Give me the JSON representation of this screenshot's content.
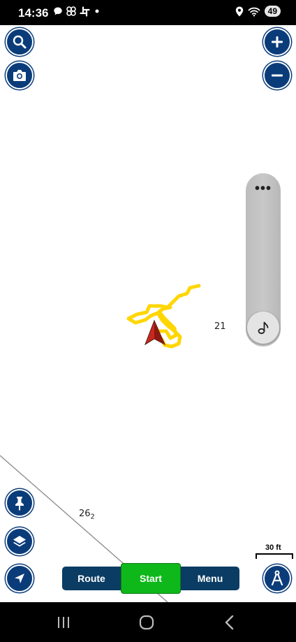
{
  "status_bar": {
    "time": "14:36",
    "battery": "49",
    "left_icons": [
      "chat-bubble-icon",
      "pinwheel-icon",
      "slack-icon",
      "dot-icon"
    ],
    "right_icons": [
      "location-icon",
      "wifi-icon",
      "battery-icon"
    ]
  },
  "map": {
    "labels": {
      "depth_21": "21",
      "depth_26": "26",
      "depth_26_sub": "2"
    },
    "scale_label": "30 ft",
    "track_color": "#ffd600",
    "arrow_color": "#c8281e"
  },
  "side_buttons": {
    "search": "search-icon",
    "camera": "camera-icon",
    "zoom_in": "plus-icon",
    "zoom_out": "minus-icon",
    "pin": "pin-icon",
    "layers": "layers-icon",
    "locate": "navigation-arrow-icon",
    "compass": "compass-icon"
  },
  "slider": {
    "more": "•••",
    "knob_icon": "music-note-icon"
  },
  "bottom_bar": {
    "route_label": "Route",
    "start_label": "Start",
    "menu_label": "Menu"
  },
  "colors": {
    "brand_blue": "#0b3c7a",
    "bar_blue": "#0b3c63",
    "start_green": "#0eb81a"
  }
}
